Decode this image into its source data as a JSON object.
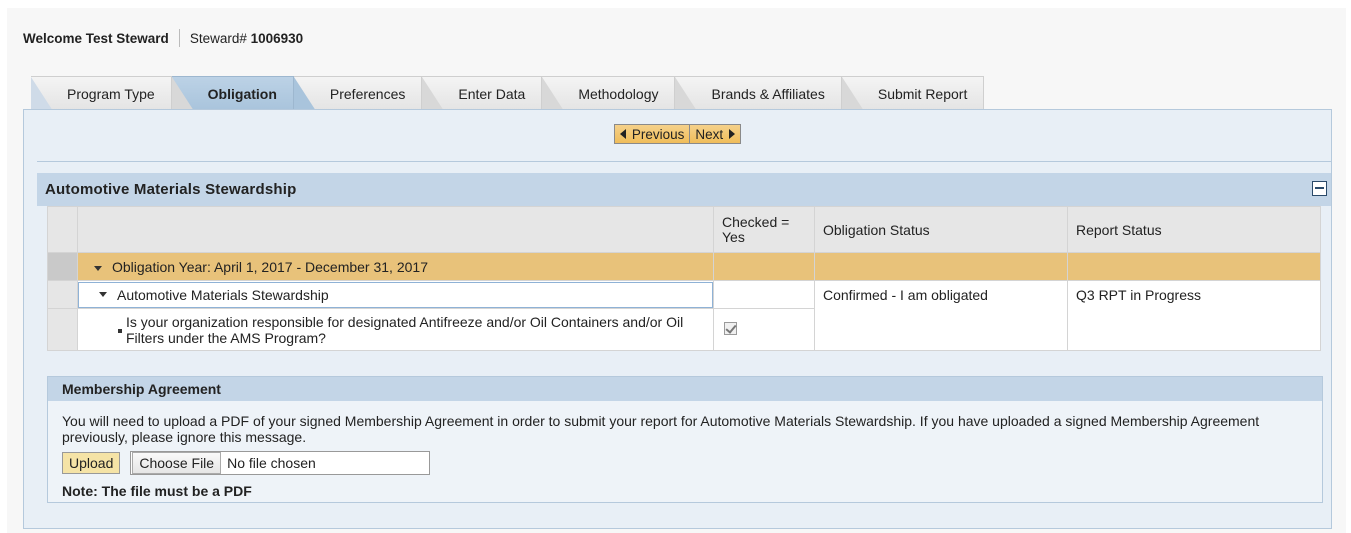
{
  "header": {
    "welcome": "Welcome Test Steward",
    "steward_label": "Steward#",
    "steward_number": "1006930"
  },
  "tabs": [
    {
      "label": "Program Type",
      "active": false
    },
    {
      "label": "Obligation",
      "active": true
    },
    {
      "label": "Preferences",
      "active": false
    },
    {
      "label": "Enter Data",
      "active": false
    },
    {
      "label": "Methodology",
      "active": false
    },
    {
      "label": "Brands & Affiliates",
      "active": false
    },
    {
      "label": "Submit Report",
      "active": false
    }
  ],
  "nav": {
    "previous": "Previous",
    "next": "Next"
  },
  "section": {
    "title": "Automotive Materials Stewardship"
  },
  "table": {
    "columns": [
      "",
      "Checked = Yes",
      "Obligation Status",
      "Report Status"
    ],
    "year_row": "Obligation Year: April 1, 2017 - December 31, 2017",
    "program_row": "Automotive Materials Stewardship",
    "question": "Is your organization responsible for designated Antifreeze and/or Oil Containers and/or Oil Filters under the AMS Program?",
    "obligation_status": "Confirmed - I am obligated",
    "report_status": "Q3 RPT in Progress",
    "checked": true
  },
  "membership": {
    "title": "Membership Agreement",
    "message": "You will need to upload a PDF of your signed Membership Agreement in order to submit your report for Automotive Materials Stewardship. If you have uploaded a signed Membership Agreement previously, please ignore this message.",
    "upload_label": "Upload",
    "choose_label": "Choose File",
    "file_status": "No file chosen",
    "note": "Note: The file must be a PDF"
  },
  "colors": {
    "accent": "#c3d5e7",
    "year_row": "#e8c27a",
    "nav_button": "#f0bd5a"
  }
}
